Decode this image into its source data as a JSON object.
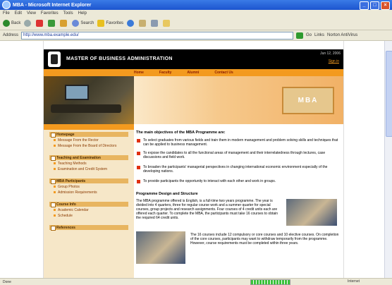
{
  "window": {
    "title": "MBA - Microsoft Internet Explorer"
  },
  "menu": [
    "File",
    "Edit",
    "View",
    "Favorites",
    "Tools",
    "Help"
  ],
  "toolbar": {
    "back": "Back",
    "search": "Search",
    "favorites": "Favorites"
  },
  "address": {
    "label": "Address",
    "value": "http://www.mba.example.edu/",
    "go": "Go",
    "links": "Links",
    "tools": "Norton AntiVirus"
  },
  "status": {
    "text": "Done",
    "zone": "Internet"
  },
  "page": {
    "header_title": "MASTER OF BUSINESS ADMINISTRATION",
    "date": "Jun 12, 2006",
    "signin": "Sign in",
    "topnav": [
      "Home",
      "Faculty",
      "Alumni",
      "Contact Us"
    ],
    "hero_sign": "MBA",
    "sidebar": [
      {
        "head": "Homepage",
        "items": [
          "Message From the Rector",
          "Message From the Board of Directors"
        ]
      },
      {
        "head": "Teaching and Examination",
        "items": [
          "Teaching Methods",
          "Examination and Credit System"
        ]
      },
      {
        "head": "MBA Participants",
        "items": [
          "Group Photos",
          "Admission Requirements"
        ]
      },
      {
        "head": "Course Info",
        "items": [
          "Academic Calendar",
          "Schedule"
        ]
      },
      {
        "head": "References",
        "items": []
      }
    ],
    "content": {
      "heading": "The main objectives of the MBA Programme are:",
      "bullets": [
        "To select graduates from various fields and train them in modern management and problem solving skills and techniques that can be applied to business management.",
        "To expose the candidates to all the functional areas of management and their interrelatedness through lectures, case discussions and field work.",
        "To broaden the participants' managerial perspectives in changing international economic environment especially of the developing nations.",
        "To provide participants the opportunity to interact with each other and work in groups."
      ],
      "section_title": "Programme Design and Structure",
      "para1": "The MBA programme offered is English, is a full-time two years programme. The year is divided into 4 quarters, three for regular course work and a summer quarter for special courses, group projects and research assignments. Four courses of 4 credit units each are offered each quarter. To complete the MBA, the participants must take 16 courses to obtain the required 64 credit units.",
      "para2": "The 16 courses include 12 compulsory or core courses and 10 elective courses. On completion of the core courses, participants may want to withdraw temporarily from the programme. However, course requirements must be completed within three years."
    }
  }
}
